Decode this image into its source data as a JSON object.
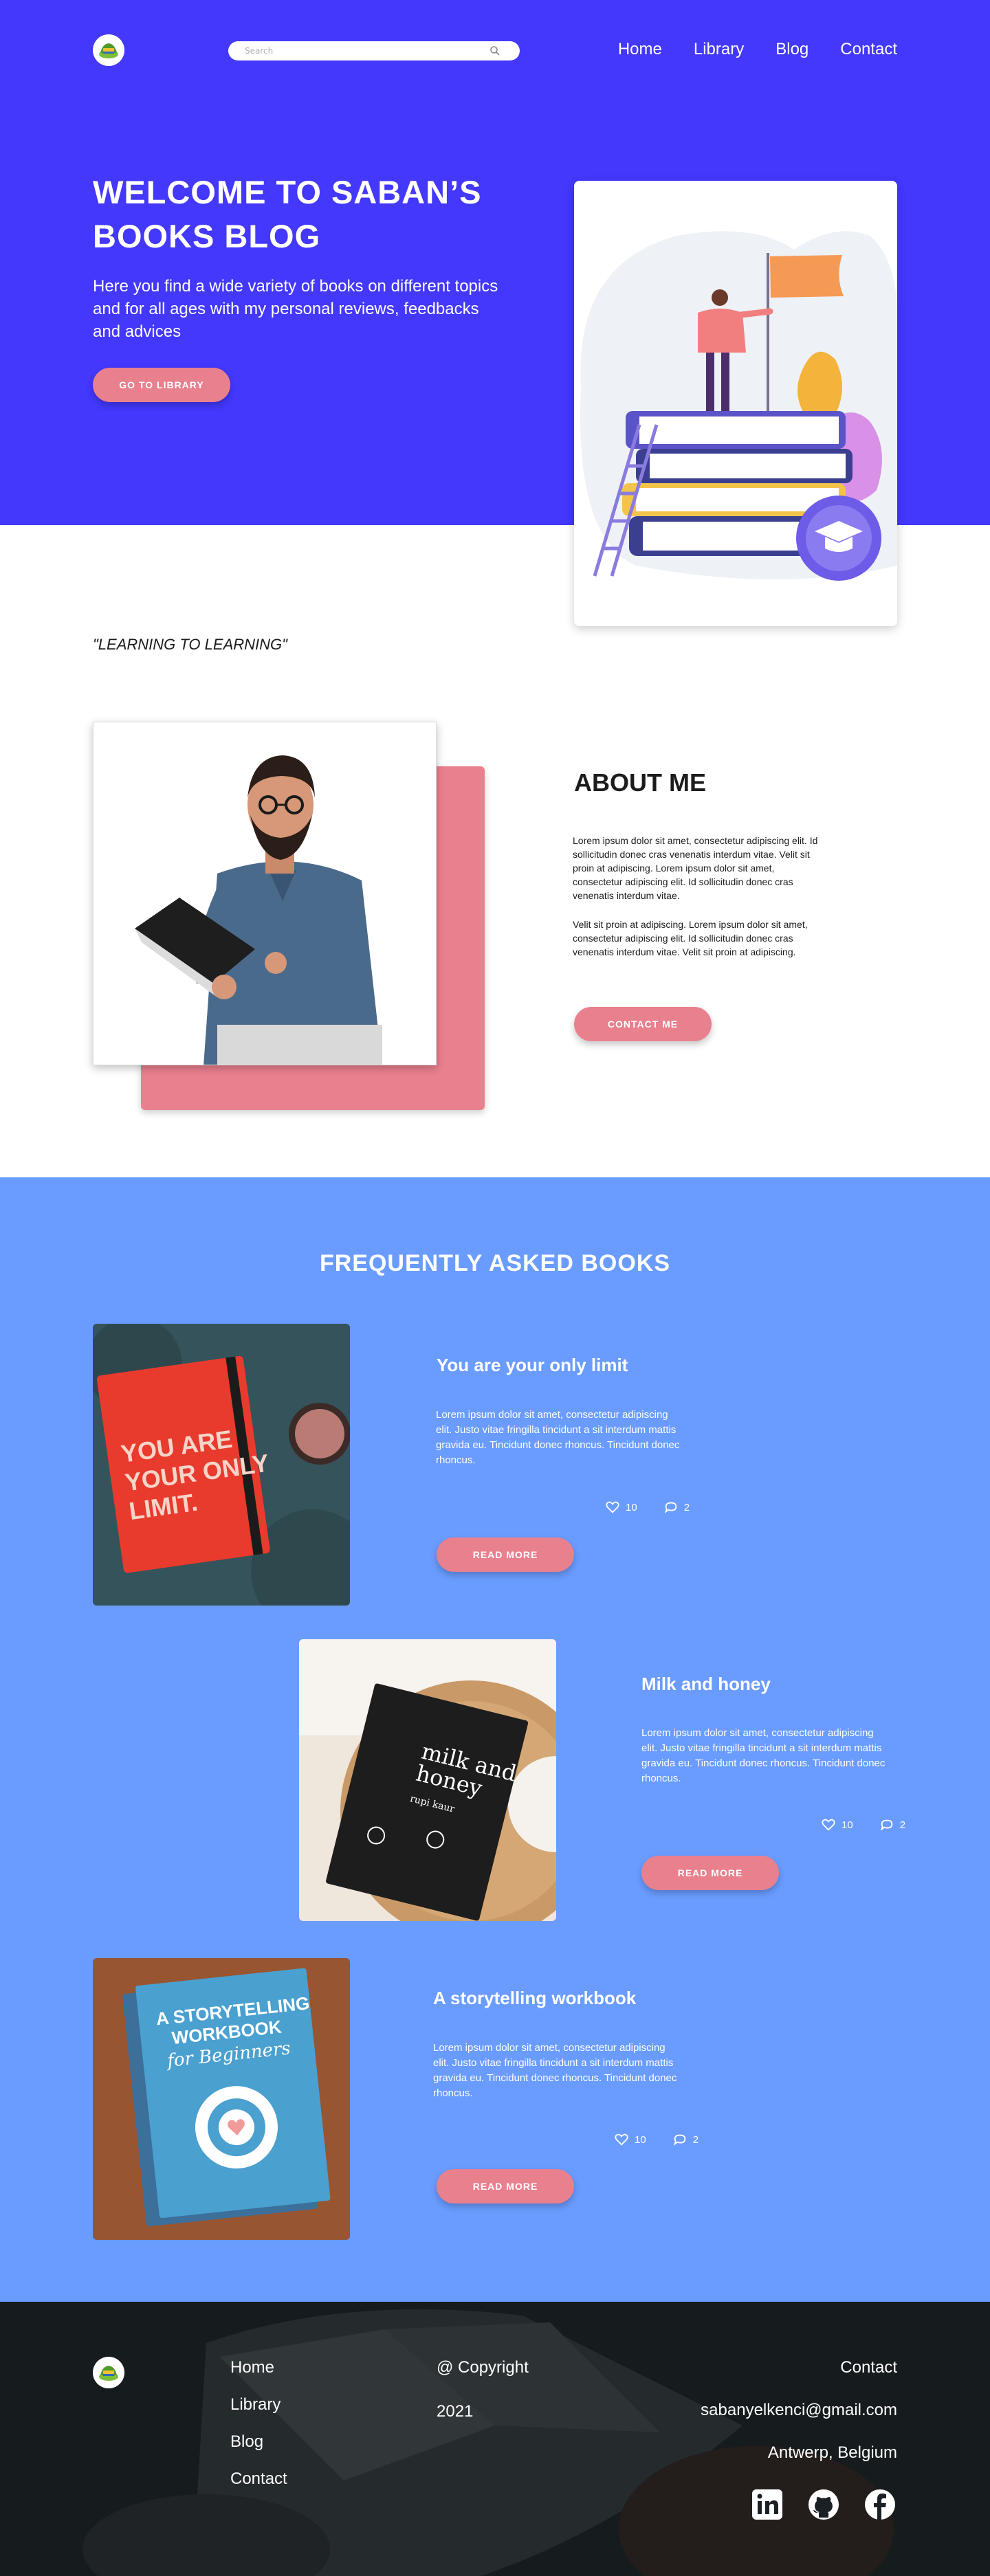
{
  "header": {
    "search_placeholder": "Search",
    "nav": [
      "Home",
      "Library",
      "Blog",
      "Contact"
    ]
  },
  "hero": {
    "title": "WELCOME TO SABAN’S BOOKS BLOG",
    "text": "Here you find a wide variety of books on different topics and for all ages with my personal reviews, feedbacks and advices",
    "button": "GO TO LIBRARY",
    "quote": "\"LEARNING TO LEARNING\""
  },
  "about": {
    "title": "ABOUT ME",
    "p1": "Lorem ipsum dolor sit amet, consectetur adipiscing elit. Id sollicitudin donec cras venenatis interdum vitae. Velit sit proin at adipiscing. Lorem ipsum dolor sit amet, consectetur adipiscing elit. Id sollicitudin donec cras venenatis interdum vitae.",
    "p2": "Velit sit proin at adipiscing. Lorem ipsum dolor sit amet, consectetur adipiscing elit. Id sollicitudin donec cras venenatis interdum vitae. Velit sit proin at adipiscing.",
    "button": "CONTACT ME"
  },
  "faq": {
    "title": "FREQUENTLY ASKED BOOKS",
    "books": [
      {
        "title": "You are your only limit",
        "cover_text": "YOU ARE YOUR ONLY LIMIT.",
        "text": "Lorem ipsum dolor sit amet, consectetur adipiscing elit. Justo vitae fringilla tincidunt a sit interdum mattis gravida eu. Tincidunt donec rhoncus. Tincidunt donec rhoncus.",
        "likes": "10",
        "comments": "2",
        "button": "READ MORE"
      },
      {
        "title": "Milk and honey",
        "cover_text": "milk and honey",
        "cover_author": "rupi kaur",
        "text": "Lorem ipsum dolor sit amet, consectetur adipiscing elit. Justo vitae fringilla tincidunt a sit interdum mattis gravida eu. Tincidunt donec rhoncus. Tincidunt donec rhoncus.",
        "likes": "10",
        "comments": "2",
        "button": "READ MORE"
      },
      {
        "title": "A storytelling workbook",
        "cover_text": "A STORYTELLING WORKBOOK",
        "cover_sub": "for Beginners",
        "text": "Lorem ipsum dolor sit amet, consectetur adipiscing elit. Justo vitae fringilla tincidunt a sit interdum mattis gravida eu. Tincidunt donec rhoncus. Tincidunt donec rhoncus.",
        "likes": "10",
        "comments": "2",
        "button": "READ MORE"
      }
    ]
  },
  "footer": {
    "links": [
      "Home",
      "Library",
      "Blog",
      "Contact"
    ],
    "copyright": "@ Copyright",
    "year": "2021",
    "contact_title": "Contact",
    "email": "sabanyelkenci@gmail.com",
    "location": "Antwerp, Belgium",
    "social": [
      "linkedin-icon",
      "github-icon",
      "facebook-icon"
    ]
  },
  "colors": {
    "hero_bg": "#4338fb",
    "faq_bg": "#6a9cff",
    "accent": "#e9808e",
    "footer_bg": "#1a1e20"
  }
}
